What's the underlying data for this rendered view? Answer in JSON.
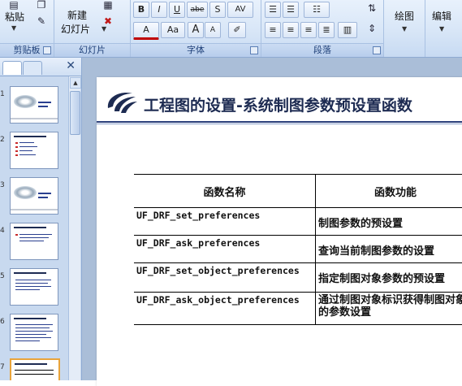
{
  "ribbon": {
    "clipboard": {
      "paste": "粘贴",
      "label": "剪贴板"
    },
    "slides": {
      "new_slide": "新建",
      "new_slide_2": "幻灯片",
      "label": "幻灯片"
    },
    "font": {
      "bold": "B",
      "italic": "I",
      "underline": "U",
      "strike": "abe",
      "shadow": "S",
      "spacing": "AV",
      "font_color": "A",
      "change_case": "Aa",
      "grow": "A",
      "shrink": "A",
      "label": "字体"
    },
    "paragraph": {
      "label": "段落"
    },
    "drawing": {
      "label": "绘图"
    },
    "editing": {
      "label": "编辑"
    }
  },
  "pane": {
    "close": "✕",
    "slides": [
      {
        "num": "1"
      },
      {
        "num": "2"
      },
      {
        "num": "3"
      },
      {
        "num": "4"
      },
      {
        "num": "5"
      },
      {
        "num": "6"
      },
      {
        "num": "7"
      }
    ]
  },
  "slide": {
    "title": "工程图的设置-系统制图参数预设置函数",
    "table": {
      "headers": [
        "函数名称",
        "函数功能"
      ],
      "rows": [
        {
          "name": "UF_DRF_set_preferences",
          "desc": "制图参数的预设置"
        },
        {
          "name": "UF_DRF_ask_preferences",
          "desc": "查询当前制图参数的设置"
        },
        {
          "name": "UF_DRF_set_object_preferences",
          "desc": "指定制图对象参数的预设置"
        },
        {
          "name": "UF_DRF_ask_object_preferences",
          "desc": "通过制图对象标识获得制图对象的参数设置"
        }
      ]
    }
  }
}
